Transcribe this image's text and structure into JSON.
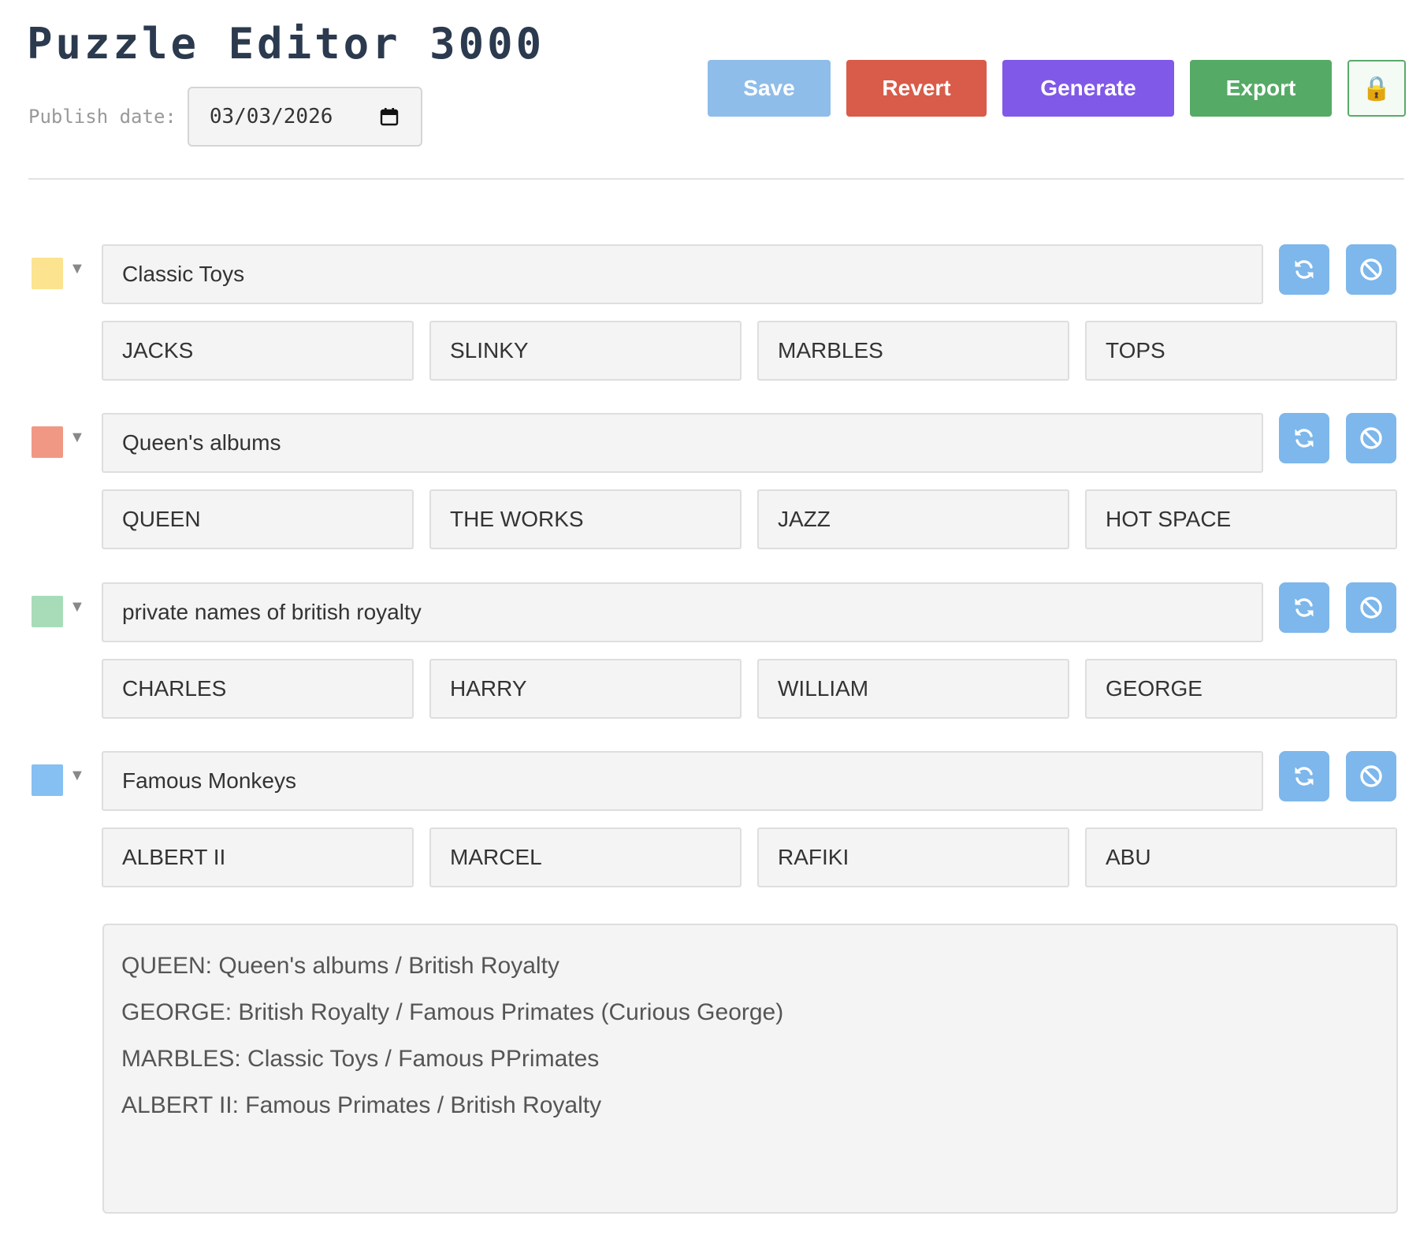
{
  "app": {
    "title": "Puzzle Editor 3000"
  },
  "publish": {
    "label": "Publish date:",
    "date": "03/03/2026"
  },
  "toolbar": {
    "save": "Save",
    "revert": "Revert",
    "generate": "Generate",
    "export": "Export",
    "lock_icon": "🔒"
  },
  "colors": {
    "save": "#8fbde9",
    "revert": "#d95b49",
    "generate": "#8159e8",
    "export": "#55aa66",
    "icon_button": "#7db7eb"
  },
  "groups": [
    {
      "color": "#fbe38f",
      "name": "Classic Toys",
      "words": [
        "JACKS",
        "SLINKY",
        "MARBLES",
        "TOPS"
      ]
    },
    {
      "color": "#f19884",
      "name": "Queen's albums",
      "words": [
        "QUEEN",
        "THE WORKS",
        "JAZZ",
        "HOT SPACE"
      ]
    },
    {
      "color": "#a8dcb9",
      "name": "private names of british royalty",
      "words": [
        "CHARLES",
        "HARRY",
        "WILLIAM",
        "GEORGE"
      ]
    },
    {
      "color": "#86bff2",
      "name": "Famous Monkeys",
      "words": [
        "ALBERT II",
        "MARCEL",
        "RAFIKI",
        "ABU"
      ]
    }
  ],
  "group_icons": {
    "regenerate": "refresh-icon",
    "exclude": "ban-icon",
    "expand": "▼"
  },
  "notes": {
    "lines": [
      "QUEEN: Queen's albums / British Royalty",
      "GEORGE: British Royalty / Famous Primates (Curious George)",
      "MARBLES: Classic Toys / Famous PPrimates",
      "ALBERT II: Famous Primates / British Royalty"
    ]
  }
}
